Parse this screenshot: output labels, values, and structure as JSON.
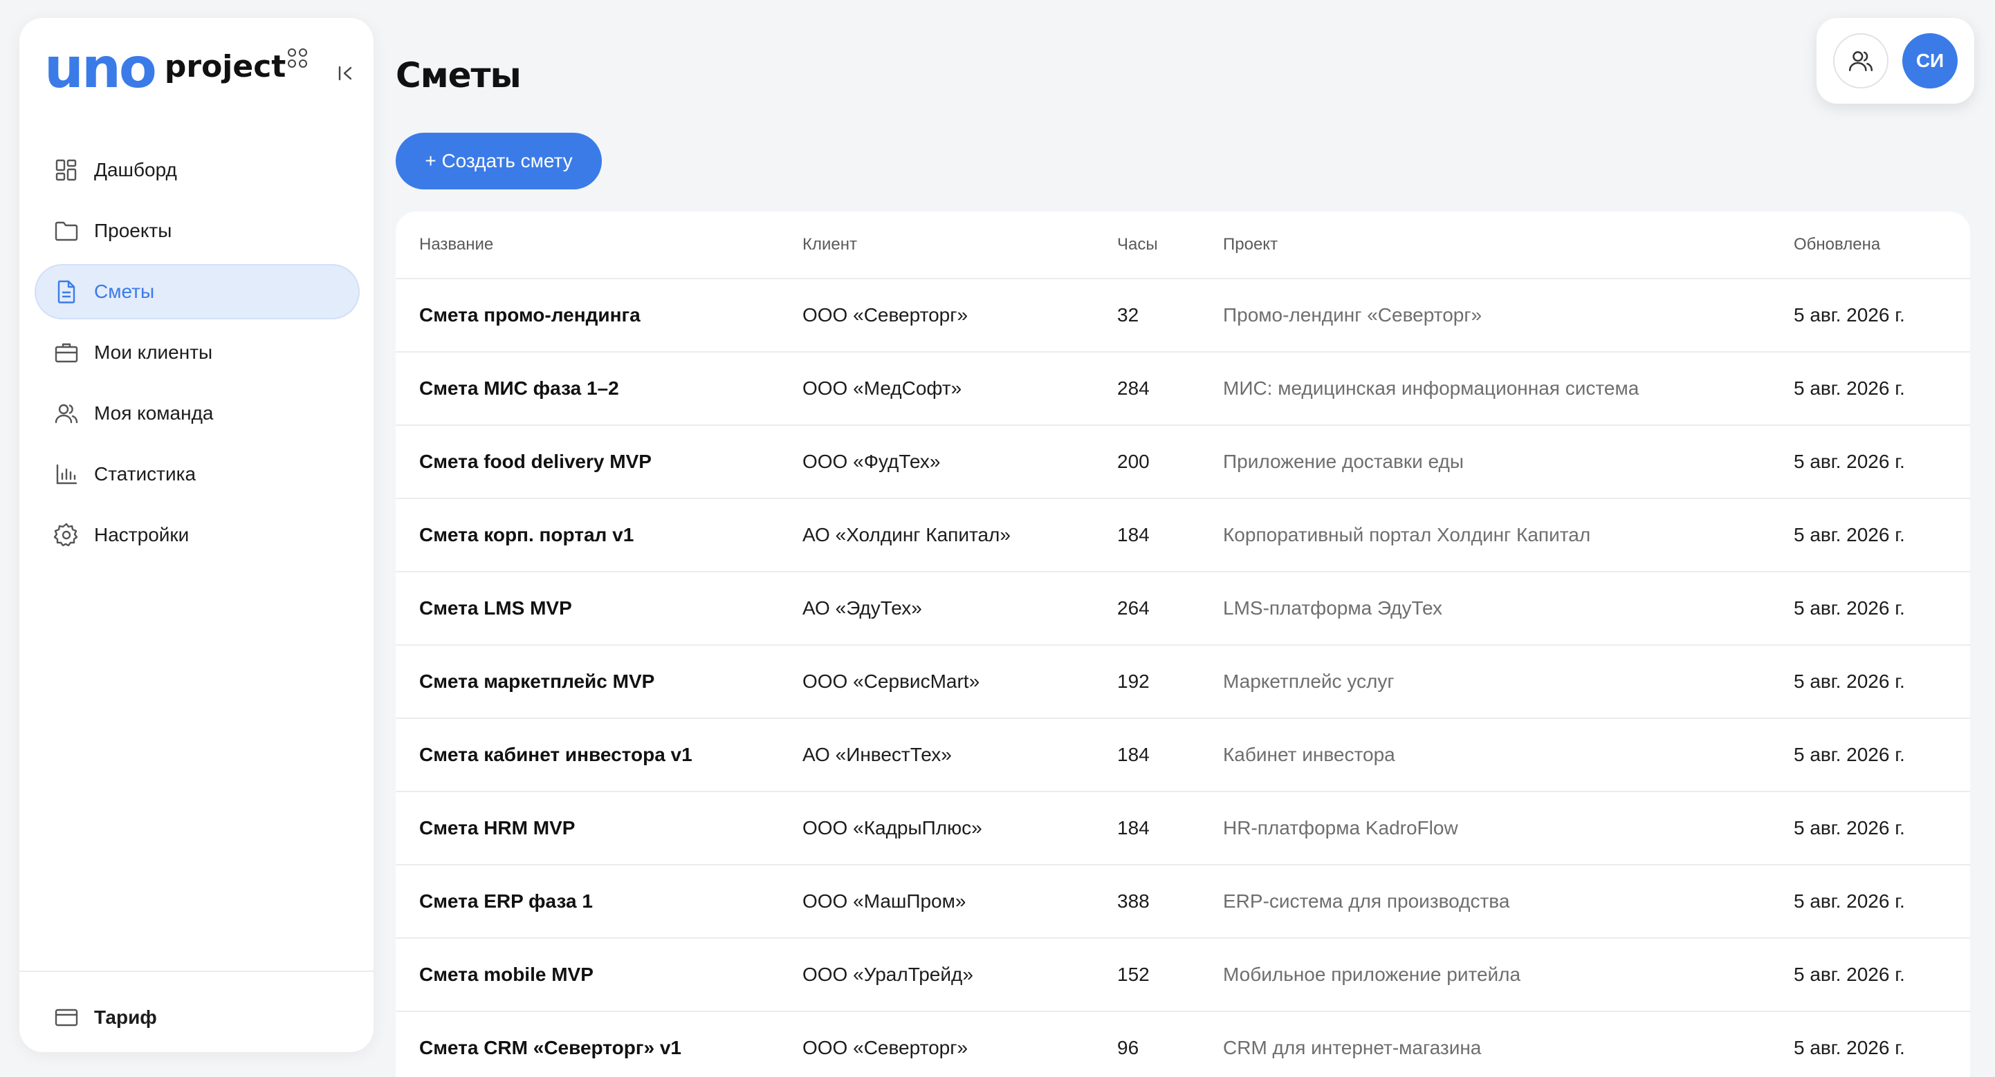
{
  "brand": {
    "logo_mark": "uno",
    "product": "project"
  },
  "sidebar": {
    "items": [
      {
        "label": "Дашборд",
        "icon": "dashboard-icon",
        "active": false
      },
      {
        "label": "Проекты",
        "icon": "folder-icon",
        "active": false
      },
      {
        "label": "Сметы",
        "icon": "document-icon",
        "active": true
      },
      {
        "label": "Мои клиенты",
        "icon": "briefcase-icon",
        "active": false
      },
      {
        "label": "Моя команда",
        "icon": "team-icon",
        "active": false
      },
      {
        "label": "Статистика",
        "icon": "bar-chart-icon",
        "active": false
      },
      {
        "label": "Настройки",
        "icon": "gear-icon",
        "active": false
      }
    ],
    "footer": {
      "label": "Тариф",
      "icon": "card-icon"
    }
  },
  "header": {
    "title": "Сметы",
    "create_label": "+ Создать смету",
    "avatar_initials": "СИ"
  },
  "table": {
    "columns": [
      "Название",
      "Клиент",
      "Часы",
      "Проект",
      "Обновлена"
    ],
    "rows": [
      [
        "Смета промо-лендинга",
        "ООО «Северторг»",
        "32",
        "Промо-лендинг «Северторг»",
        "5 авг. 2026 г."
      ],
      [
        "Смета МИС фаза 1–2",
        "ООО «МедСофт»",
        "284",
        "МИС: медицинская информационная система",
        "5 авг. 2026 г."
      ],
      [
        "Смета food delivery MVP",
        "ООО «ФудТех»",
        "200",
        "Приложение доставки еды",
        "5 авг. 2026 г."
      ],
      [
        "Смета корп. портал v1",
        "АО «Холдинг Капитал»",
        "184",
        "Корпоративный портал Холдинг Капитал",
        "5 авг. 2026 г."
      ],
      [
        "Смета LMS MVP",
        "АО «ЭдуТех»",
        "264",
        "LMS-платформа ЭдуТех",
        "5 авг. 2026 г."
      ],
      [
        "Смета маркетплейс MVP",
        "ООО «СервисMart»",
        "192",
        "Маркетплейс услуг",
        "5 авг. 2026 г."
      ],
      [
        "Смета кабинет инвестора v1",
        "АО «ИнвестТех»",
        "184",
        "Кабинет инвестора",
        "5 авг. 2026 г."
      ],
      [
        "Смета HRM MVP",
        "ООО «КадрыПлюс»",
        "184",
        "HR-платформа KadroFlow",
        "5 авг. 2026 г."
      ],
      [
        "Смета ERP фаза 1",
        "ООО «МашПром»",
        "388",
        "ERP-система для производства",
        "5 авг. 2026 г."
      ],
      [
        "Смета mobile MVP",
        "ООО «УралТрейд»",
        "152",
        "Мобильное приложение ритейла",
        "5 авг. 2026 г."
      ],
      [
        "Смета CRM «Северторг» v1",
        "ООО «Северторг»",
        "96",
        "CRM для интернет-магазина",
        "5 авг. 2026 г."
      ]
    ]
  },
  "colors": {
    "accent": "#3a7be8",
    "active_bg": "#e3ecfb",
    "background": "#f4f5f7"
  }
}
